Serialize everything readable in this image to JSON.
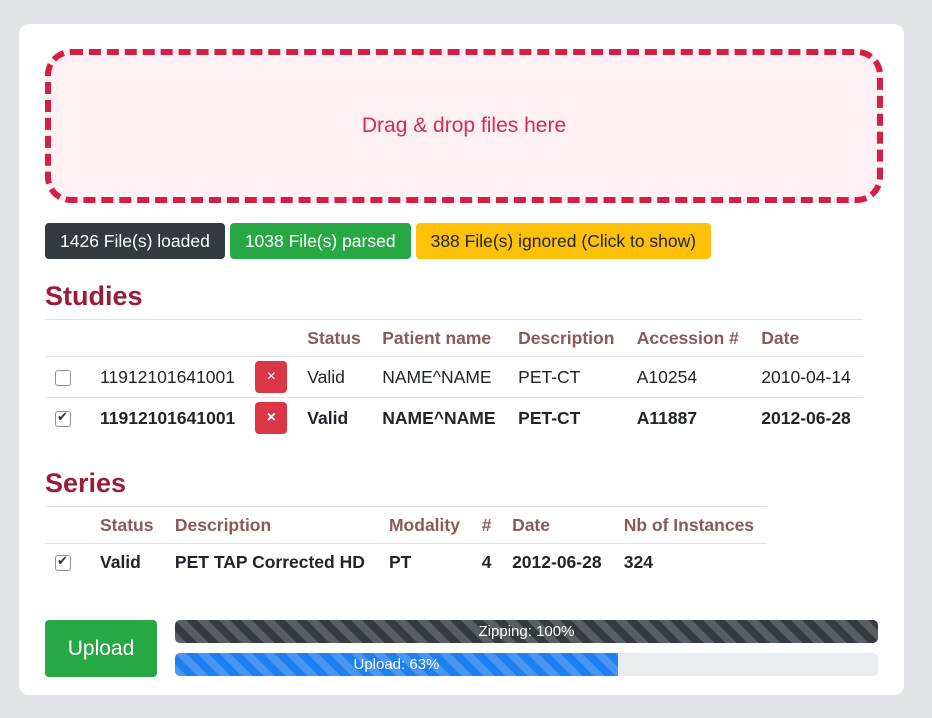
{
  "dropzone": {
    "text": "Drag & drop files here"
  },
  "badges": {
    "loaded": "1426 File(s) loaded",
    "parsed": "1038 File(s) parsed",
    "ignored": "388 File(s) ignored (Click to show)"
  },
  "studies": {
    "title": "Studies",
    "headers": [
      "Status",
      "Patient name",
      "Description",
      "Accession #",
      "Date"
    ],
    "rows": [
      {
        "checked": false,
        "id": "11912101641001",
        "delete_label": "×",
        "status": "Valid",
        "patient": "NAME^NAME",
        "description": "PET-CT",
        "accession": "A10254",
        "date": "2010-04-14"
      },
      {
        "checked": true,
        "id": "11912101641001",
        "delete_label": "×",
        "status": "Valid",
        "patient": "NAME^NAME",
        "description": "PET-CT",
        "accession": "A11887",
        "date": "2012-06-28"
      }
    ]
  },
  "series": {
    "title": "Series",
    "headers": [
      "Status",
      "Description",
      "Modality",
      "#",
      "Date",
      "Nb of Instances"
    ],
    "rows": [
      {
        "checked": true,
        "status": "Valid",
        "description": "PET TAP Corrected HD",
        "modality": "PT",
        "number": "4",
        "date": "2012-06-28",
        "instances": "324"
      }
    ]
  },
  "upload": {
    "button_label": "Upload",
    "zipping_label": "Zipping: 100%",
    "zipping_progress": 100,
    "upload_label": "Upload: 63%",
    "upload_progress": 63
  },
  "colors": {
    "dropzone_border": "#d31f48",
    "section_title": "#9b1b3a",
    "badge_dark": "#343a40",
    "badge_green": "#28a745",
    "badge_yellow": "#ffc107",
    "delete_red": "#dc3545",
    "progress_blue": "#1e7ff0"
  },
  "icons": {
    "delete": "close-icon",
    "checkbox": "checkbox"
  }
}
